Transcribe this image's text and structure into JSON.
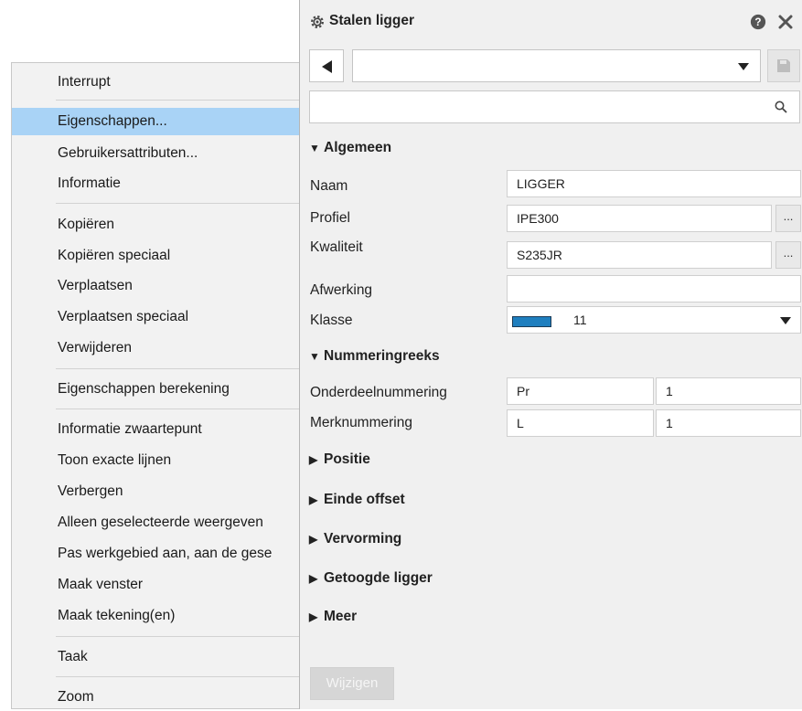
{
  "context_menu": {
    "items": [
      {
        "label": "Interrupt"
      },
      {
        "label": "Eigenschappen..."
      },
      {
        "label": "Gebruikersattributen..."
      },
      {
        "label": "Informatie"
      },
      {
        "label": "Kopiëren"
      },
      {
        "label": "Kopiëren speciaal"
      },
      {
        "label": "Verplaatsen"
      },
      {
        "label": "Verplaatsen speciaal"
      },
      {
        "label": "Verwijderen"
      },
      {
        "label": "Eigenschappen berekening"
      },
      {
        "label": "Informatie zwaartepunt"
      },
      {
        "label": "Toon exacte lijnen"
      },
      {
        "label": "Verbergen"
      },
      {
        "label": "Alleen geselecteerde weergeven"
      },
      {
        "label": "Pas werkgebied aan, aan de gese"
      },
      {
        "label": "Maak venster"
      },
      {
        "label": "Maak tekening(en)"
      },
      {
        "label": "Taak"
      },
      {
        "label": "Zoom"
      }
    ],
    "highlighted": "Eigenschappen..."
  },
  "panel": {
    "title": "Stalen ligger",
    "preset_value": "",
    "search_value": "",
    "sections": {
      "algemeen": "Algemeen",
      "nummeringreeks": "Nummeringreeks",
      "positie": "Positie",
      "einde_offset": "Einde offset",
      "vervorming": "Vervorming",
      "getoogde_ligger": "Getoogde ligger",
      "meer": "Meer"
    },
    "fields": {
      "naam": {
        "label": "Naam",
        "value": "LIGGER"
      },
      "profiel": {
        "label": "Profiel",
        "value": "IPE300"
      },
      "kwaliteit": {
        "label": "Kwaliteit",
        "value": "S235JR"
      },
      "afwerking": {
        "label": "Afwerking",
        "value": ""
      },
      "klasse": {
        "label": "Klasse",
        "value": "11",
        "swatch_color": "#1f7fbf"
      },
      "onderdeelnummering": {
        "label": "Onderdeelnummering",
        "prefix": "Pr",
        "start": "1"
      },
      "merknummering": {
        "label": "Merknummering",
        "prefix": "L",
        "start": "1"
      }
    },
    "dots_label": "...",
    "apply_label": "Wijzigen"
  },
  "colors": {
    "highlight": "#a9d3f6",
    "panel_bg": "#f0f0f0",
    "menu_bg": "#f2f2f2"
  }
}
